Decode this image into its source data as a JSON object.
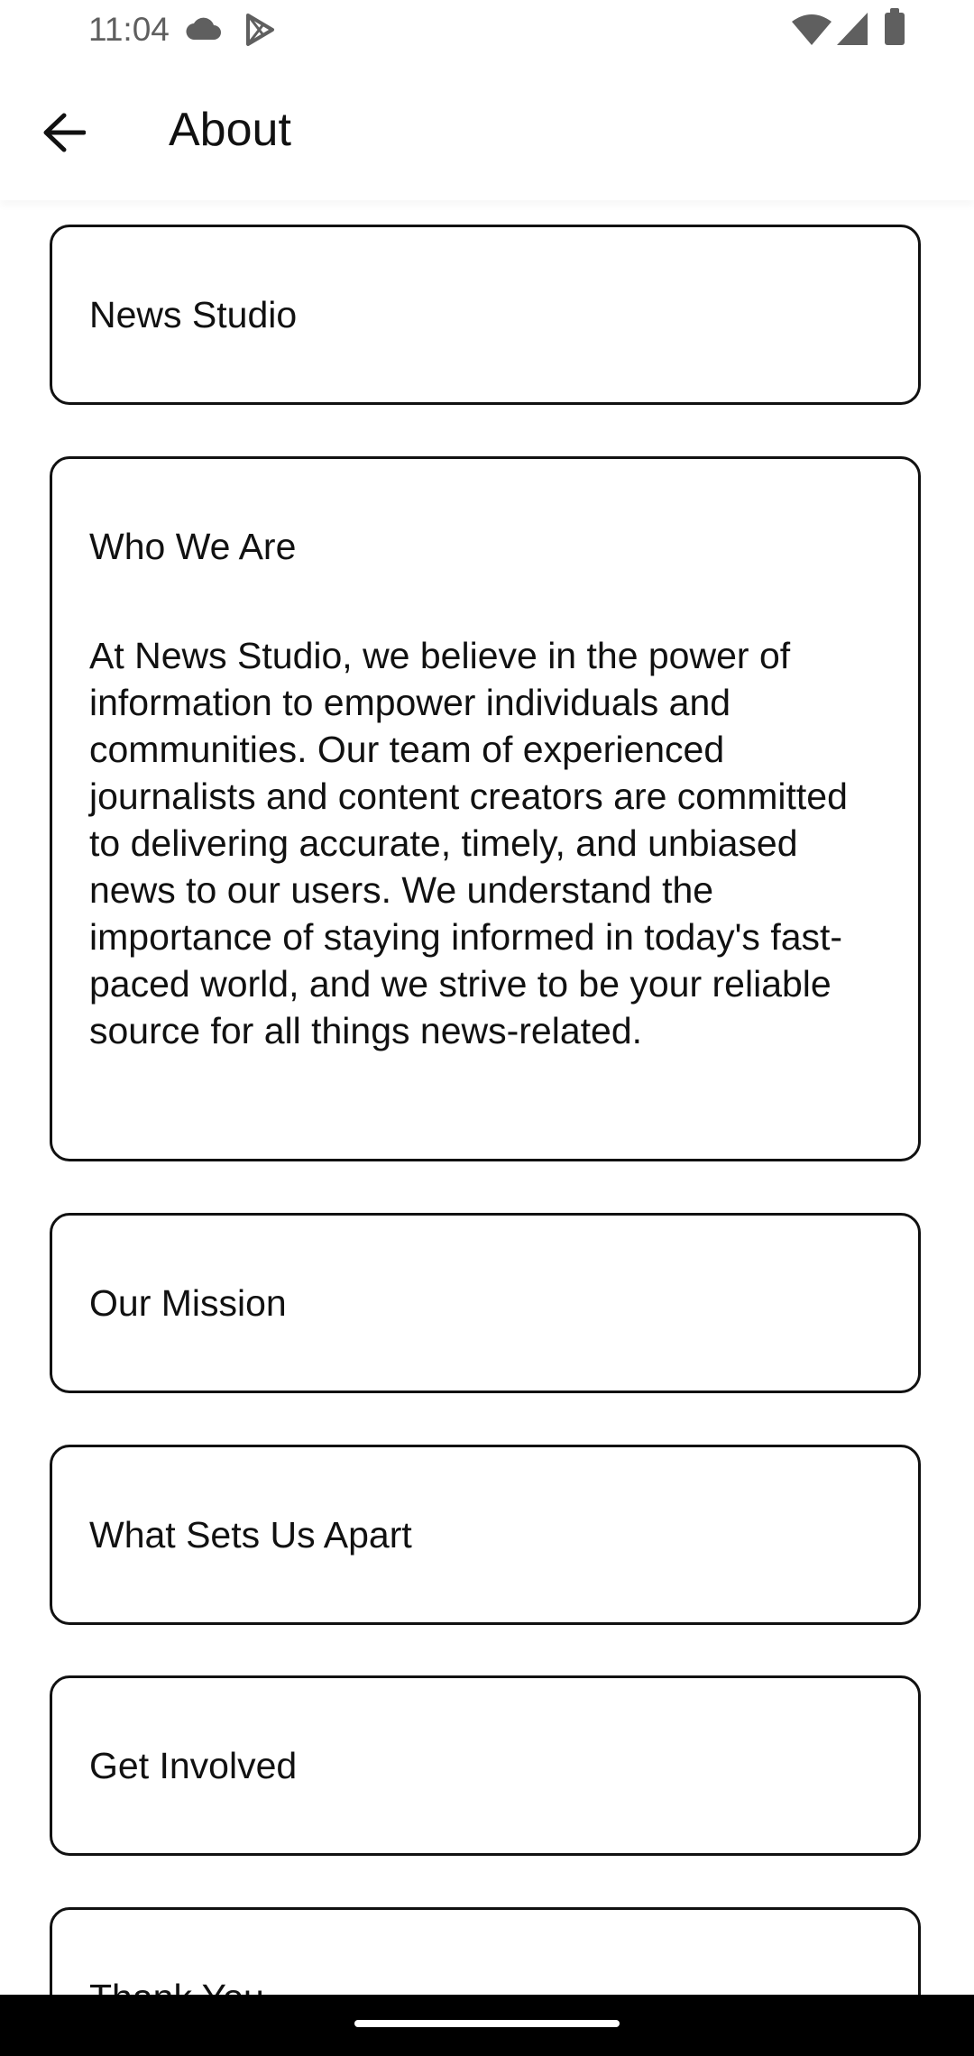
{
  "status_bar": {
    "time": "11:04",
    "icons": [
      "cloud-icon",
      "play-store-icon",
      "wifi-icon",
      "signal-icon",
      "battery-icon"
    ]
  },
  "app_bar": {
    "back_icon": "arrow-left-icon",
    "title": "About"
  },
  "sections": [
    {
      "title": "News Studio",
      "expanded": false
    },
    {
      "title": "Who We Are",
      "expanded": true,
      "body": "At News Studio, we believe in the power of information to empower individuals and communities. Our team of experienced journalists and content creators are committed to delivering accurate, timely, and unbiased news to our users. We understand the importance of staying informed in today's fast-paced world, and we strive to be your reliable source for all things news-related."
    },
    {
      "title": "Our Mission",
      "expanded": false
    },
    {
      "title": "What Sets Us Apart",
      "expanded": false
    },
    {
      "title": "Get Involved",
      "expanded": false
    },
    {
      "title": "Thank You",
      "expanded": false
    }
  ],
  "colors": {
    "background": "#ffffff",
    "text": "#111111",
    "status_icons": "#5f5f5f",
    "card_border": "#111111",
    "nav_bar": "#000000"
  }
}
